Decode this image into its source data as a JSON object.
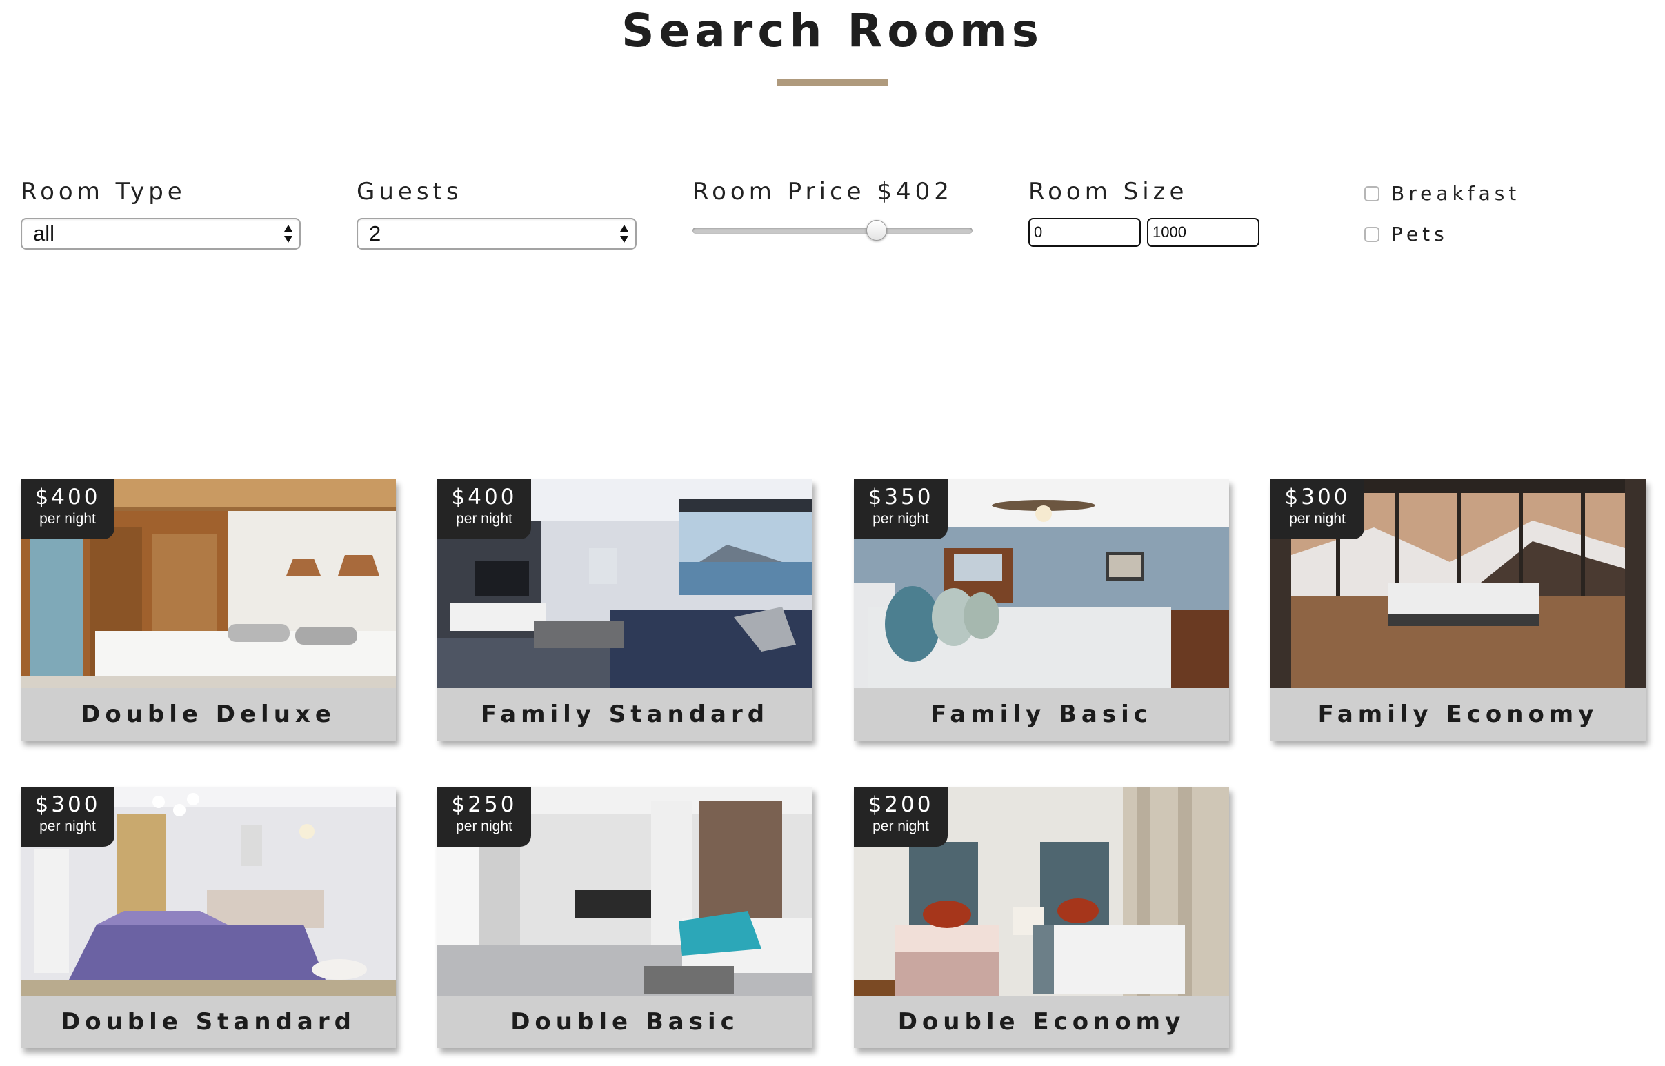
{
  "header": {
    "title": "Search Rooms"
  },
  "filters": {
    "room_type": {
      "label": "Room Type",
      "value": "all"
    },
    "guests": {
      "label": "Guests",
      "value": "2"
    },
    "room_price": {
      "label": "Room Price $402",
      "min": 0,
      "max": 600,
      "value": 402
    },
    "room_size": {
      "label": "Room Size",
      "min_value": "0",
      "max_value": "1000"
    },
    "breakfast": {
      "label": "Breakfast",
      "checked": false
    },
    "pets": {
      "label": "Pets",
      "checked": false
    }
  },
  "rooms": [
    {
      "name": "Double Deluxe",
      "price": "$400",
      "per": "per night",
      "image": "bedroom-with-ceiling-fan-and-wood-shutters"
    },
    {
      "name": "Family Standard",
      "price": "$400",
      "per": "per night",
      "image": "living-room-with-sea-view"
    },
    {
      "name": "Family Basic",
      "price": "$350",
      "per": "per night",
      "image": "blue-wall-bedroom-with-dresser"
    },
    {
      "name": "Family Economy",
      "price": "$300",
      "per": "per night",
      "image": "bedroom-with-mountain-view"
    },
    {
      "name": "Double Standard",
      "price": "$300",
      "per": "per night",
      "image": "purple-bedspread-bedroom"
    },
    {
      "name": "Double Basic",
      "price": "$250",
      "per": "per night",
      "image": "open-studio-with-teal-bed"
    },
    {
      "name": "Double Economy",
      "price": "$200",
      "per": "per night",
      "image": "twin-beds-with-red-pillows"
    }
  ],
  "colors": {
    "accent": "#af9a7d",
    "badge": "#242424",
    "card_footer": "#cfcfcf"
  }
}
